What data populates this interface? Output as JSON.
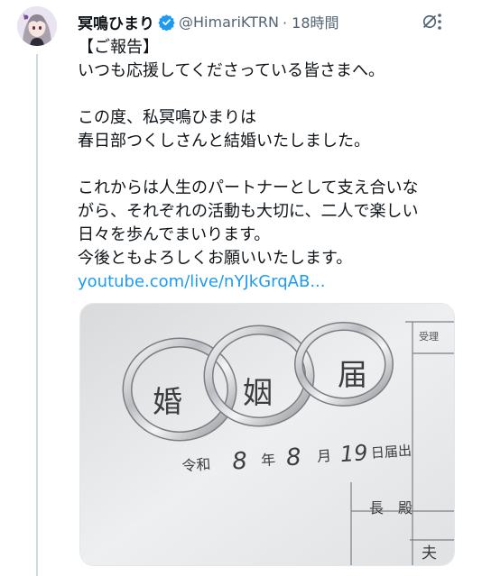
{
  "author": {
    "display_name": "冥鳴ひまり",
    "handle": "@HimariKTRN",
    "time": "· 18時間"
  },
  "tweet": {
    "lines": [
      "【ご報告】",
      "いつも応援してくださっている皆さまへ。",
      "",
      "この度、私冥鳴ひまりは",
      "春日部つくしさんと結婚いたしました。",
      "",
      "これからは人生のパートナーとして支え合いな",
      "がら、それぞれの活動も大切に、二人で楽しい",
      "日々を歩んでまいります。",
      "今後ともよろしくお願いいたします。"
    ],
    "link": "youtube.com/live/nYJkGrqAB..."
  },
  "photo": {
    "document_chars": [
      "婚",
      "姻",
      "届"
    ],
    "date_text": {
      "era": "令和",
      "year": "8",
      "year_unit": "年",
      "month": "8",
      "month_unit": "月",
      "day": "19",
      "suffix": "日届出"
    },
    "office_text": "長　殿",
    "corner_label": "受理",
    "bottom_char": "夫"
  },
  "colors": {
    "link": "#1d9bf0",
    "verified": "#1d9bf0",
    "secondary_text": "#536471"
  }
}
